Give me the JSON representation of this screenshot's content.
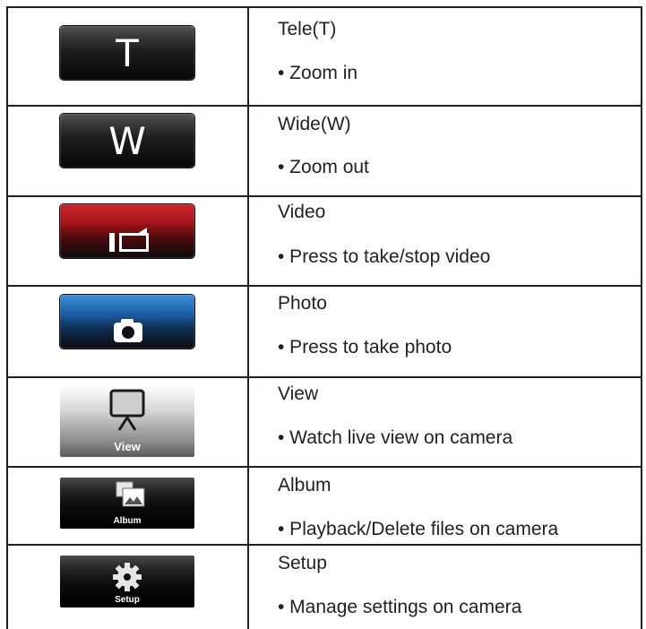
{
  "rows": [
    {
      "icon": "tele-t-button",
      "button_text": "T",
      "title": "Tele(T)",
      "desc": "• Zoom in"
    },
    {
      "icon": "wide-w-button",
      "button_text": "W",
      "title": "Wide(W)",
      "desc": "• Zoom out"
    },
    {
      "icon": "video-camera-icon",
      "title": "Video",
      "desc": "• Press to take/stop video"
    },
    {
      "icon": "camera-icon",
      "title": "Photo",
      "desc": "• Press to take photo"
    },
    {
      "icon": "monitor-icon",
      "button_text": "View",
      "title": "View",
      "desc": "• Watch live view on camera"
    },
    {
      "icon": "album-icon",
      "button_text": "Album",
      "title": "Album",
      "desc": "• Playback/Delete files on camera"
    },
    {
      "icon": "gear-icon",
      "button_text": "Setup",
      "title": "Setup",
      "desc": "• Manage settings on camera"
    }
  ],
  "colors": {
    "red": "#c9262a",
    "blue": "#1d5ea6",
    "dark": "#1e1e1e",
    "lines": "#231f20"
  }
}
